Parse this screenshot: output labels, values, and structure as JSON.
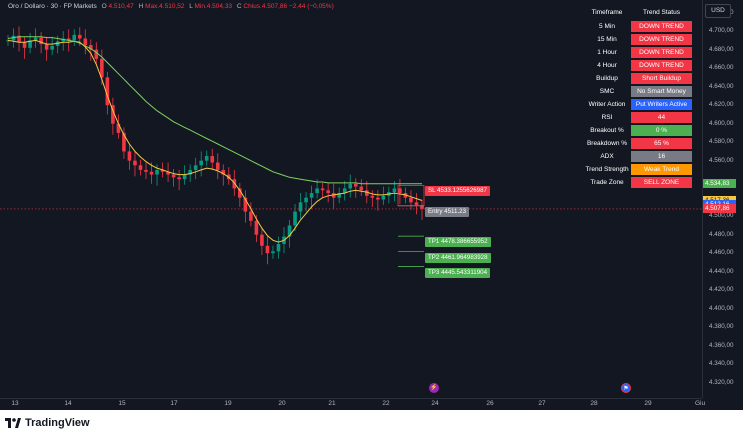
{
  "legend": {
    "symbol": "Oro / Dollaro · 30 · FP Markets",
    "open_label": "O",
    "open": "4.510,47",
    "high_label": "H",
    "high": "Max.4.510,52",
    "low_label": "L",
    "low": "Min.4.504,33",
    "close_label": "C",
    "close": "Chius.4.507,86",
    "change": "−2,44 (−0,05%)"
  },
  "currency": "USD",
  "price_axis": {
    "ticks": [
      "4.720,00",
      "4.700,00",
      "4.680,00",
      "4.660,00",
      "4.640,00",
      "4.620,00",
      "4.600,00",
      "4.580,00",
      "4.560,00",
      "4.534,83",
      "4.517,36",
      "4.512,16",
      "4.507,86",
      "4.500,00",
      "4.480,00",
      "4.460,00",
      "4.440,00",
      "4.420,00",
      "4.400,00",
      "4.380,00",
      "4.360,00",
      "4.340,00",
      "4.320,00"
    ],
    "tags": [
      {
        "label": "4.534,83",
        "color": "#4caf50",
        "text": "#ffffff"
      },
      {
        "label": "4.517,36",
        "color": "#f5c842",
        "text": "#131722"
      },
      {
        "label": "4.512,16",
        "color": "#2962ff",
        "text": "#ffffff"
      },
      {
        "label": "4.507,86",
        "color": "#f23645",
        "text": "#ffffff"
      }
    ]
  },
  "time_axis": [
    "13",
    "14",
    "15",
    "17",
    "19",
    "20",
    "21",
    "22",
    "24",
    "26",
    "27",
    "28",
    "29",
    "Giu"
  ],
  "status_table": {
    "header": {
      "timeframe": "Timeframe",
      "status": "Trend Status"
    },
    "rows": [
      {
        "key": "5 Min",
        "value": "DOWN TREND",
        "color": "#f23645"
      },
      {
        "key": "15 Min",
        "value": "DOWN TREND",
        "color": "#f23645"
      },
      {
        "key": "1 Hour",
        "value": "DOWN TREND",
        "color": "#f23645"
      },
      {
        "key": "4 Hour",
        "value": "DOWN TREND",
        "color": "#f23645"
      },
      {
        "key": "Buildup",
        "value": "Short Buildup",
        "color": "#f23645"
      },
      {
        "key": "SMC",
        "value": "No Smart Money",
        "color": "#787b86"
      },
      {
        "key": "Writer Action",
        "value": "Put Writers Active",
        "color": "#2962ff"
      },
      {
        "key": "RSI",
        "value": "44",
        "color": "#f23645"
      },
      {
        "key": "Breakout %",
        "value": "0 %",
        "color": "#4caf50"
      },
      {
        "key": "Breakdown %",
        "value": "65 %",
        "color": "#f23645"
      },
      {
        "key": "ADX",
        "value": "16",
        "color": "#787b86"
      },
      {
        "key": "Trend Strength",
        "value": "Weak Trend",
        "color": "#ff9800"
      },
      {
        "key": "Trade Zone",
        "value": "SELL ZONE",
        "color": "#f23645"
      }
    ]
  },
  "levels": {
    "sl": "SL 4533.1255626987",
    "entry": "Entry 4511.23",
    "tp1": "TP1 4478.386655952",
    "tp2": "TP2 4461.964983928",
    "tp3": "TP3 4445.543311904"
  },
  "chart_data": {
    "type": "candlestick",
    "symbol": "Oro / Dollaro",
    "timeframe": "30",
    "ylim": [
      4310,
      4725
    ],
    "series": [
      {
        "name": "close",
        "values": [
          4690,
          4695,
          4688,
          4682,
          4690,
          4693,
          4686,
          4680,
          4684,
          4689,
          4692,
          4690,
          4696,
          4692,
          4685,
          4680,
          4670,
          4650,
          4620,
          4600,
          4590,
          4570,
          4560,
          4555,
          4550,
          4548,
          4545,
          4550,
          4548,
          4545,
          4542,
          4540,
          4545,
          4550,
          4555,
          4560,
          4565,
          4558,
          4550,
          4545,
          4540,
          4530,
          4520,
          4505,
          4495,
          4480,
          4468,
          4460,
          4462,
          4470,
          4478,
          4490,
          4505,
          4515,
          4520,
          4525,
          4530,
          4528,
          4525,
          4520,
          4525,
          4530,
          4535,
          4532,
          4528,
          4522,
          4520,
          4518,
          4522,
          4526,
          4530,
          4525,
          4520,
          4515,
          4512,
          4508
        ]
      },
      {
        "name": "ma_fast",
        "values": [
          4690,
          4689,
          4688,
          4688,
          4689,
          4690,
          4688,
          4686,
          4686,
          4687,
          4688,
          4688,
          4689,
          4688,
          4683,
          4676,
          4664,
          4648,
          4630,
          4614,
          4600,
          4588,
          4578,
          4570,
          4564,
          4559,
          4555,
          4552,
          4550,
          4548,
          4546,
          4545,
          4545,
          4546,
          4548,
          4550,
          4552,
          4551,
          4549,
          4546,
          4542,
          4536,
          4528,
          4518,
          4508,
          4497,
          4487,
          4479,
          4474,
          4472,
          4474,
          4479,
          4487,
          4496,
          4503,
          4510,
          4516,
          4520,
          4522,
          4523,
          4524,
          4525,
          4527,
          4528,
          4527,
          4526,
          4524,
          4523,
          4523,
          4524,
          4525,
          4524,
          4523,
          4521,
          4519,
          4517
        ]
      },
      {
        "name": "ma_slow",
        "values": [
          4692,
          4693,
          4694,
          4694,
          4694,
          4694,
          4694,
          4693,
          4693,
          4692,
          4691,
          4690,
          4689,
          4687,
          4684,
          4681,
          4677,
          4672,
          4666,
          4660,
          4654,
          4648,
          4642,
          4636,
          4630,
          4624,
          4619,
          4614,
          4610,
          4606,
          4602,
          4599,
          4596,
          4593,
          4590,
          4587,
          4584,
          4581,
          4578,
          4575,
          4572,
          4569,
          4566,
          4563,
          4560,
          4557,
          4554,
          4551,
          4548,
          4546,
          4544,
          4542,
          4541,
          4540,
          4539,
          4538,
          4537,
          4537,
          4536,
          4536,
          4536,
          4536,
          4536,
          4536,
          4535,
          4535,
          4535,
          4535,
          4535,
          4535,
          4535,
          4535,
          4535,
          4535,
          4535,
          4535
        ]
      }
    ],
    "levels": {
      "sl": 4533.13,
      "entry": 4511.23,
      "tp1": 4478.39,
      "tp2": 4461.96,
      "tp3": 4445.54
    }
  }
}
